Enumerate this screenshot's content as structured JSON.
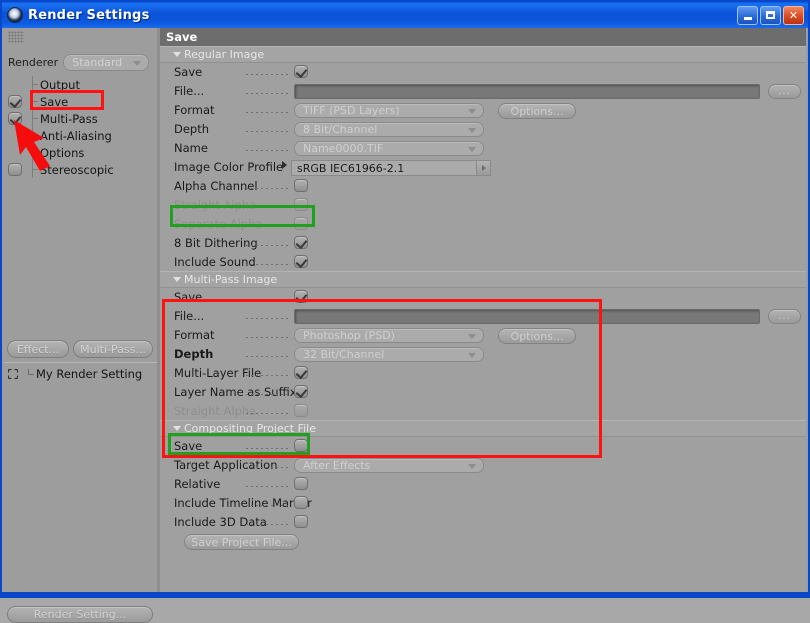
{
  "window": {
    "title": "Render Settings",
    "icon": "c4d-orb-icon",
    "buttons": {
      "minimize": "_",
      "maximize": "□",
      "close": "✕"
    }
  },
  "left_panel": {
    "renderer_label": "Renderer",
    "renderer_value": "Standard",
    "tree": [
      {
        "label": "Output",
        "checkbox": false,
        "has_checkbox": false
      },
      {
        "label": "Save",
        "checkbox": true,
        "has_checkbox": true
      },
      {
        "label": "Multi-Pass",
        "checkbox": true,
        "has_checkbox": true
      },
      {
        "label": "Anti-Aliasing",
        "checkbox": false,
        "has_checkbox": false
      },
      {
        "label": "Options",
        "checkbox": false,
        "has_checkbox": false
      },
      {
        "label": "Stereoscopic",
        "checkbox": false,
        "has_checkbox": true
      }
    ],
    "effect_button": "Effect...",
    "multipass_button": "Multi-Pass...",
    "render_setting_item": "My Render Setting",
    "render_setting_button": "Render Setting..."
  },
  "panel": {
    "title": "Save",
    "groups": [
      {
        "title": "Regular Image",
        "rows": [
          {
            "label": "Save",
            "type": "checkbox",
            "checked": true,
            "disabled": false
          },
          {
            "label": "File...",
            "type": "file",
            "value": "",
            "browse": "..."
          },
          {
            "label": "Format",
            "type": "combo",
            "value": "TIFF (PSD Layers)",
            "button": "Options..."
          },
          {
            "label": "Depth",
            "type": "combo",
            "value": "8 Bit/Channel"
          },
          {
            "label": "Name",
            "type": "combo",
            "value": "Name0000.TIF"
          },
          {
            "label": "Image Color Profile",
            "type": "profile",
            "value": "sRGB IEC61966-2.1"
          },
          {
            "label": "Alpha Channel",
            "type": "checkbox",
            "checked": false,
            "disabled": false
          },
          {
            "label": "Straight Alpha",
            "type": "checkbox",
            "checked": false,
            "disabled": true
          },
          {
            "label": "Separate Alpha",
            "type": "checkbox",
            "checked": false,
            "disabled": true
          },
          {
            "label": "8 Bit Dithering",
            "type": "checkbox",
            "checked": true,
            "disabled": false
          },
          {
            "label": "Include Sound",
            "type": "checkbox",
            "checked": true,
            "disabled": false
          }
        ]
      },
      {
        "title": "Multi-Pass Image",
        "rows": [
          {
            "label": "Save",
            "type": "checkbox",
            "checked": true,
            "disabled": false
          },
          {
            "label": "File...",
            "type": "file",
            "value": "",
            "browse": "..."
          },
          {
            "label": "Format",
            "type": "combo",
            "value": "Photoshop (PSD)",
            "button": "Options..."
          },
          {
            "label": "Depth",
            "type": "combo",
            "value": "32 Bit/Channel",
            "bold": true
          },
          {
            "label": "Multi-Layer File",
            "type": "checkbox",
            "checked": true,
            "disabled": false
          },
          {
            "label": "Layer Name as Suffix",
            "type": "checkbox",
            "checked": true,
            "disabled": false
          },
          {
            "label": "Straight Alpha",
            "type": "checkbox",
            "checked": false,
            "disabled": true
          }
        ]
      },
      {
        "title": "Compositing Project File",
        "rows": [
          {
            "label": "Save",
            "type": "checkbox",
            "checked": false,
            "disabled": false
          },
          {
            "label": "Target Application",
            "type": "combo",
            "value": "After Effects"
          },
          {
            "label": "Relative",
            "type": "checkbox",
            "checked": false,
            "disabled": false
          },
          {
            "label": "Include Timeline Marker",
            "type": "checkbox",
            "checked": false,
            "disabled": false
          },
          {
            "label": "Include 3D Data",
            "type": "checkbox",
            "checked": false,
            "disabled": false
          },
          {
            "label": "Save Project File...",
            "type": "button"
          }
        ]
      }
    ]
  },
  "annotations": {
    "red_color": "#ff1212",
    "green_color": "#1fa01f",
    "boxes": [
      {
        "name": "save-tree-highlight",
        "color": "red"
      },
      {
        "name": "multipass-group-highlight",
        "color": "red"
      },
      {
        "name": "alpha-channel-highlight",
        "color": "green"
      },
      {
        "name": "straight-alpha-highlight",
        "color": "green"
      }
    ],
    "arrow": {
      "name": "checkbox-pointer-arrow",
      "color": "#ff1212"
    }
  }
}
